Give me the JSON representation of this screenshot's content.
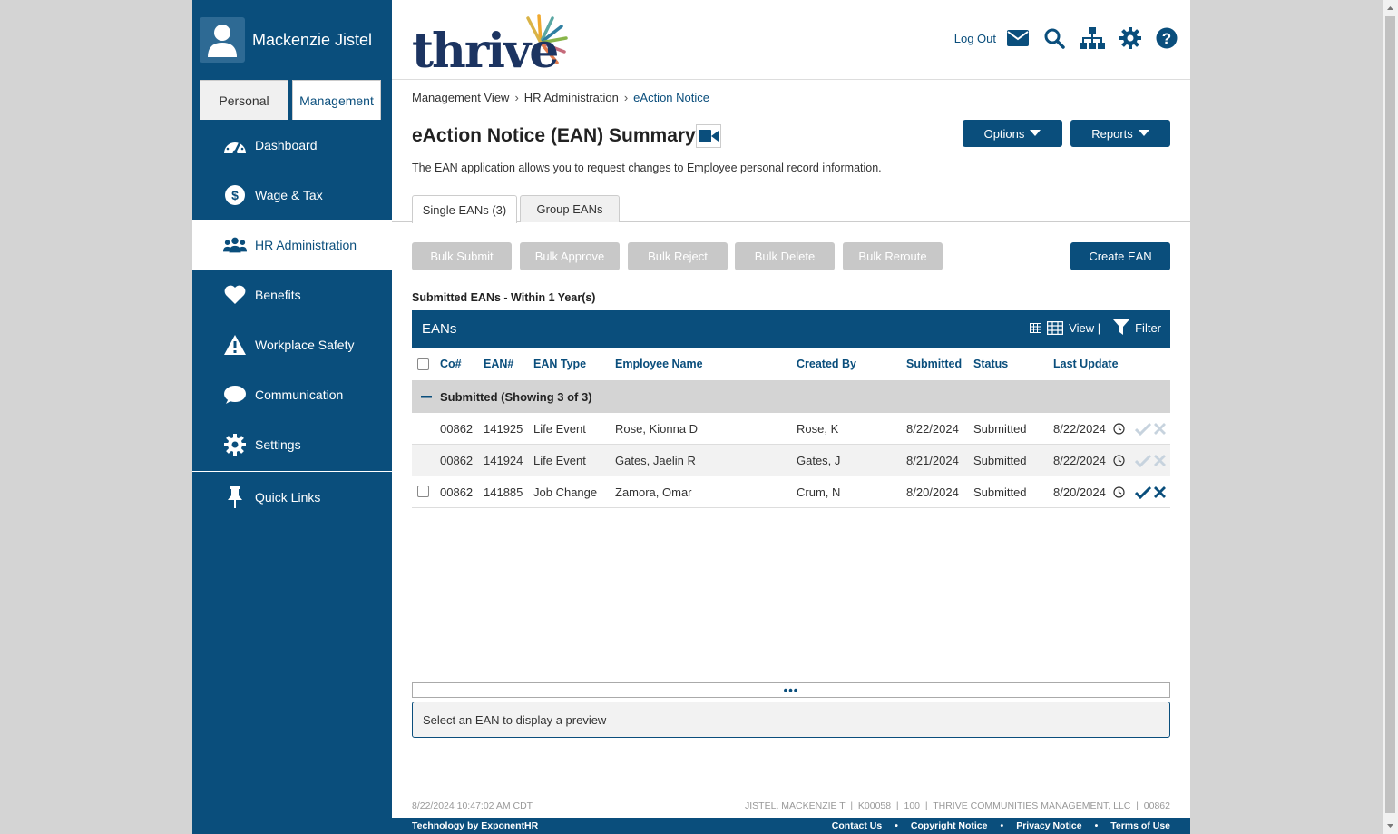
{
  "user": {
    "name": "Mackenzie Jistel"
  },
  "view_tabs": [
    {
      "label": "Personal"
    },
    {
      "label": "Management"
    }
  ],
  "nav": [
    {
      "label": "Dashboard",
      "icon": "dashboard-icon"
    },
    {
      "label": "Wage & Tax",
      "icon": "dollar-icon"
    },
    {
      "label": "HR Administration",
      "icon": "users-icon"
    },
    {
      "label": "Benefits",
      "icon": "heart-icon"
    },
    {
      "label": "Workplace Safety",
      "icon": "warning-icon"
    },
    {
      "label": "Communication",
      "icon": "chat-icon"
    },
    {
      "label": "Settings",
      "icon": "gear-icon"
    },
    {
      "label": "Quick Links",
      "icon": "pin-icon"
    }
  ],
  "header": {
    "logo": "thrive",
    "logout": "Log Out"
  },
  "breadcrumb": [
    "Management View",
    "HR Administration",
    "eAction Notice"
  ],
  "page": {
    "title": "eAction Notice (EAN) Summary",
    "description": "The EAN application allows you to request changes to Employee personal record information.",
    "options_label": "Options",
    "reports_label": "Reports"
  },
  "tabs": [
    {
      "label": "Single EANs (3)"
    },
    {
      "label": "Group EANs"
    }
  ],
  "bulk_actions": [
    "Bulk Submit",
    "Bulk Approve",
    "Bulk Reject",
    "Bulk Delete",
    "Bulk Reroute"
  ],
  "create_label": "Create EAN",
  "section_label": "Submitted EANs - Within 1 Year(s)",
  "grid": {
    "title": "EANs",
    "view_label": "View |",
    "filter_label": "Filter",
    "columns": [
      "Co#",
      "EAN#",
      "EAN Type",
      "Employee Name",
      "Created By",
      "Submitted",
      "Status",
      "Last Update"
    ],
    "group_label": "Submitted (Showing 3 of 3)",
    "rows": [
      {
        "co": "00862",
        "ean": "141925",
        "type": "Life Event",
        "employee": "Rose, Kionna D",
        "created_by": "Rose, K",
        "submitted": "8/22/2024",
        "status": "Submitted",
        "last_update": "8/22/2024"
      },
      {
        "co": "00862",
        "ean": "141924",
        "type": "Life Event",
        "employee": "Gates, Jaelin R",
        "created_by": "Gates, J",
        "submitted": "8/21/2024",
        "status": "Submitted",
        "last_update": "8/22/2024"
      },
      {
        "co": "00862",
        "ean": "141885",
        "type": "Job Change",
        "employee": "Zamora, Omar",
        "created_by": "Crum, N",
        "submitted": "8/20/2024",
        "status": "Submitted",
        "last_update": "8/20/2024"
      }
    ]
  },
  "splitter_label": "•••",
  "preview_text": "Select an EAN to display a preview",
  "status_line": {
    "timestamp": "8/22/2024 10:47:02 AM CDT",
    "info": "JISTEL, MACKENZIE T  |  K00058  |  100  |  THRIVE COMMUNITIES MANAGEMENT, LLC  |  00862"
  },
  "footer": {
    "credit": "Technology by ExponentHR",
    "links": [
      "Contact Us",
      "•",
      "Copyright Notice",
      "•",
      "Privacy Notice",
      "•",
      "Terms of Use"
    ]
  },
  "colors": {
    "brand": "#0a4e7c",
    "disabled": "#c8c8c8",
    "logo_text": "#1c3461"
  }
}
